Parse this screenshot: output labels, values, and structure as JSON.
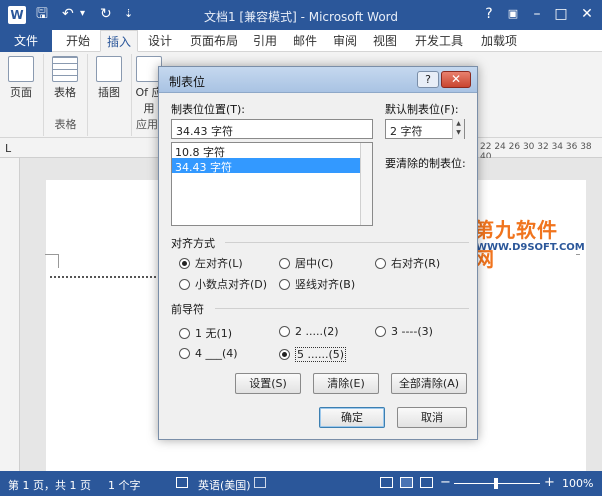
{
  "title_bar": {
    "app_icon": "W",
    "title": "文档1 [兼容模式] - Microsoft Word",
    "quick_access": [
      {
        "name": "save-icon",
        "glyph": "🖫"
      },
      {
        "name": "undo-icon",
        "glyph": "↶"
      },
      {
        "name": "undo-dropdown-icon",
        "glyph": "▾"
      },
      {
        "name": "redo-icon",
        "glyph": "↻"
      },
      {
        "name": "customize-qat-icon",
        "glyph": "⇣"
      }
    ],
    "window_buttons": [
      "?",
      "▣",
      "–",
      "□",
      "✕"
    ]
  },
  "ribbon_tabs": {
    "file": "文件",
    "items": [
      "开始",
      "插入",
      "设计",
      "页面布局",
      "引用",
      "邮件",
      "审阅",
      "视图",
      "开发工具",
      "加载项"
    ],
    "active": "插入"
  },
  "ribbon": {
    "groups": [
      {
        "label": "",
        "buttons": [
          "页面"
        ]
      },
      {
        "label": "表格",
        "buttons": [
          "表格"
        ]
      },
      {
        "label": "",
        "buttons": [
          "插图"
        ]
      },
      {
        "label": "应用",
        "buttons": [
          "Of 应用"
        ]
      }
    ]
  },
  "ruler": {
    "tab_selector": "L",
    "ticks": "22  24  26      30  32  34  36  38  40"
  },
  "dialog": {
    "title": "制表位",
    "help": "?",
    "close": "✕",
    "position_label": "制表位位置(T):",
    "position_value": "34.43 字符",
    "list_items": [
      {
        "text": "10.8 字符",
        "selected": false
      },
      {
        "text": "34.43 字符",
        "selected": true
      }
    ],
    "default_label": "默认制表位(F):",
    "default_value": "2 字符",
    "clear_label": "要清除的制表位:",
    "alignment": {
      "header": "对齐方式",
      "options": [
        {
          "label": "左对齐(L)",
          "checked": true
        },
        {
          "label": "居中(C)",
          "checked": false
        },
        {
          "label": "右对齐(R)",
          "checked": false
        },
        {
          "label": "小数点对齐(D)",
          "checked": false
        },
        {
          "label": "竖线对齐(B)",
          "checked": false
        }
      ]
    },
    "leader": {
      "header": "前导符",
      "options": [
        {
          "label": "1 无(1)",
          "checked": false
        },
        {
          "label": "2 .....(2)",
          "checked": false
        },
        {
          "label": "3 ----(3)",
          "checked": false
        },
        {
          "label": "4 ___(4)",
          "checked": false
        },
        {
          "label": "5 ......(5)",
          "checked": true
        }
      ]
    },
    "buttons": {
      "set": "设置(S)",
      "clear": "清除(E)",
      "clear_all": "全部清除(A)",
      "ok": "确定",
      "cancel": "取消"
    }
  },
  "watermark": {
    "text": "第九软件网",
    "url": "WWW.D9SOFT.COM"
  },
  "status_bar": {
    "page": "第 1 页，共 1 页",
    "words": "1 个字",
    "language": "英语(美国)",
    "zoom": "100%"
  },
  "colors": {
    "word_blue": "#2b579a",
    "selection_blue": "#3399ff",
    "close_red": "#c9452f"
  }
}
